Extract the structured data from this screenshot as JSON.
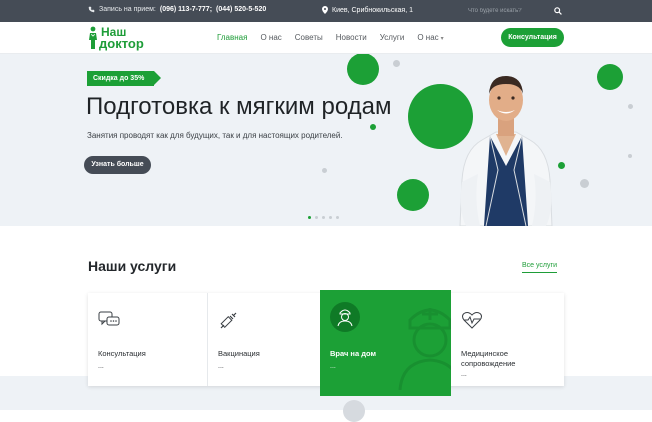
{
  "topbar": {
    "phone_label": "Запись на прием:",
    "phone_1": "(096) 113-7-777;",
    "phone_2": "(044) 520-5-520",
    "address": "Киев, Срибнокильская, 1",
    "search_placeholder": "Что будете искать?"
  },
  "header": {
    "logo_line1": "Наш",
    "logo_line2": "доктор",
    "nav": [
      {
        "label": "Главная",
        "active": true
      },
      {
        "label": "О нас"
      },
      {
        "label": "Советы"
      },
      {
        "label": "Новости"
      },
      {
        "label": "Услуги"
      },
      {
        "label": "О нас",
        "dropdown": true
      }
    ],
    "cta_label": "Консультация"
  },
  "hero": {
    "badge": "Скидка до 35%",
    "title": "Подготовка к мягким родам",
    "subtitle": "Занятия проводят как для будущих, так и для настоящих родителей.",
    "button": "Узнать больше",
    "slides_total": 5,
    "slide_active": 1
  },
  "services": {
    "title": "Наши услуги",
    "all_link": "Все услуги",
    "items": [
      {
        "name": "Консультация",
        "more": "...",
        "icon": "chat-icon"
      },
      {
        "name": "Вакцинация",
        "more": "...",
        "icon": "syringe-icon"
      },
      {
        "name": "Врач на дом",
        "more": "...",
        "icon": "doctor-icon",
        "featured": true
      },
      {
        "name": "Медицинское сопровождение",
        "more": "...",
        "icon": "heart-pulse-icon"
      }
    ]
  },
  "colors": {
    "accent": "#1ca036",
    "dark": "#454c56",
    "hero_bg": "#eef2f6"
  }
}
